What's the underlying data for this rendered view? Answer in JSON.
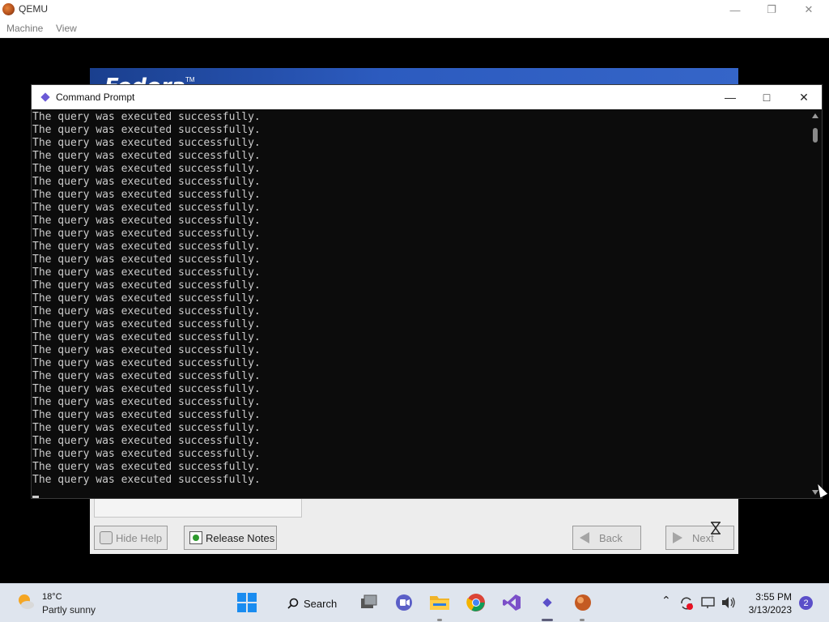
{
  "qemu": {
    "title": "QEMU",
    "menu": [
      "Machine",
      "View"
    ],
    "minimize_icon": "minimize-icon",
    "restore_icon": "restore-icon",
    "close_icon": "close-icon"
  },
  "fedora": {
    "logo_text": "Fedora",
    "tm": "TM",
    "buttons": {
      "hide_help": "Hide Help",
      "release_notes": "Release Notes",
      "back": "Back",
      "next": "Next"
    },
    "banner_color": "#2c5bbf"
  },
  "cmd": {
    "title": "Command Prompt",
    "lines": [
      "The query was executed successfully.",
      "The query was executed successfully.",
      "The query was executed successfully.",
      "The query was executed successfully.",
      "The query was executed successfully.",
      "The query was executed successfully.",
      "The query was executed successfully.",
      "The query was executed successfully.",
      "The query was executed successfully.",
      "The query was executed successfully.",
      "The query was executed successfully.",
      "The query was executed successfully.",
      "The query was executed successfully.",
      "The query was executed successfully.",
      "The query was executed successfully.",
      "The query was executed successfully.",
      "The query was executed successfully.",
      "The query was executed successfully.",
      "The query was executed successfully.",
      "The query was executed successfully.",
      "The query was executed successfully.",
      "The query was executed successfully.",
      "The query was executed successfully.",
      "The query was executed successfully.",
      "The query was executed successfully.",
      "The query was executed successfully.",
      "The query was executed successfully.",
      "The query was executed successfully.",
      "The query was executed successfully."
    ],
    "text_color": "#cccccc",
    "background": "#0c0c0c"
  },
  "taskbar": {
    "weather": {
      "temp": "18°C",
      "desc": "Partly sunny",
      "icon": "partly-sunny-icon"
    },
    "search_label": "Search",
    "apps": [
      "start-icon",
      "search-icon",
      "task-view-icon",
      "teams-icon",
      "file-explorer-icon",
      "chrome-icon",
      "visual-studio-icon",
      "command-prompt-icon",
      "qemu-icon"
    ],
    "clock": {
      "time": "3:55 PM",
      "date": "3/13/2023"
    },
    "notifications": "2"
  }
}
